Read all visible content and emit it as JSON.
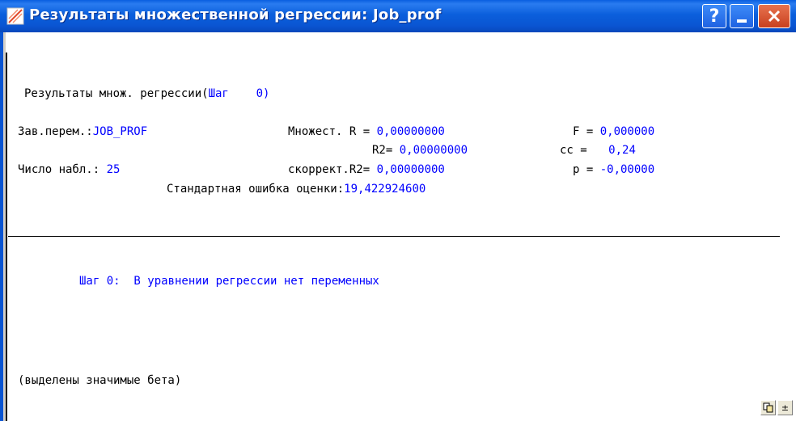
{
  "window": {
    "title": "Результаты множественной регрессии: Job_prof",
    "icons": {
      "app": "chart-icon",
      "help": "?",
      "minimize": "minimize-icon",
      "close": "close-icon"
    }
  },
  "results": {
    "header_label": "Результаты множ. регрессии(",
    "step_value": "Шаг    0)",
    "dep_var_label": "Зав.перем.:",
    "dep_var_value": "JOB_PROF",
    "multiple_r_label": "Множест. R = ",
    "multiple_r_value": "0,00000000",
    "f_label": "F = ",
    "f_value": "0,000000",
    "r2_label": "R2= ",
    "r2_value": "0,00000000",
    "cc_label": "cc = ",
    "cc_value": "0,24",
    "n_obs_label": "Число набл.: ",
    "n_obs_value": "25",
    "adj_r2_label": "скоррект.R2= ",
    "adj_r2_value": "0,00000000",
    "p_label": "p = ",
    "p_value": "-0,00000",
    "std_error_label": "Стандартная ошибка оценки:",
    "std_error_value": "19,422924600"
  },
  "step_message": "Шаг 0:  В уравнении регрессии нет переменных",
  "footnote": "(выделены значимые бета)",
  "corner_buttons": {
    "copy": "copy-icon",
    "expand": "±"
  },
  "colors": {
    "value_blue": "#0000ff",
    "titlebar": "#0a55d2"
  }
}
